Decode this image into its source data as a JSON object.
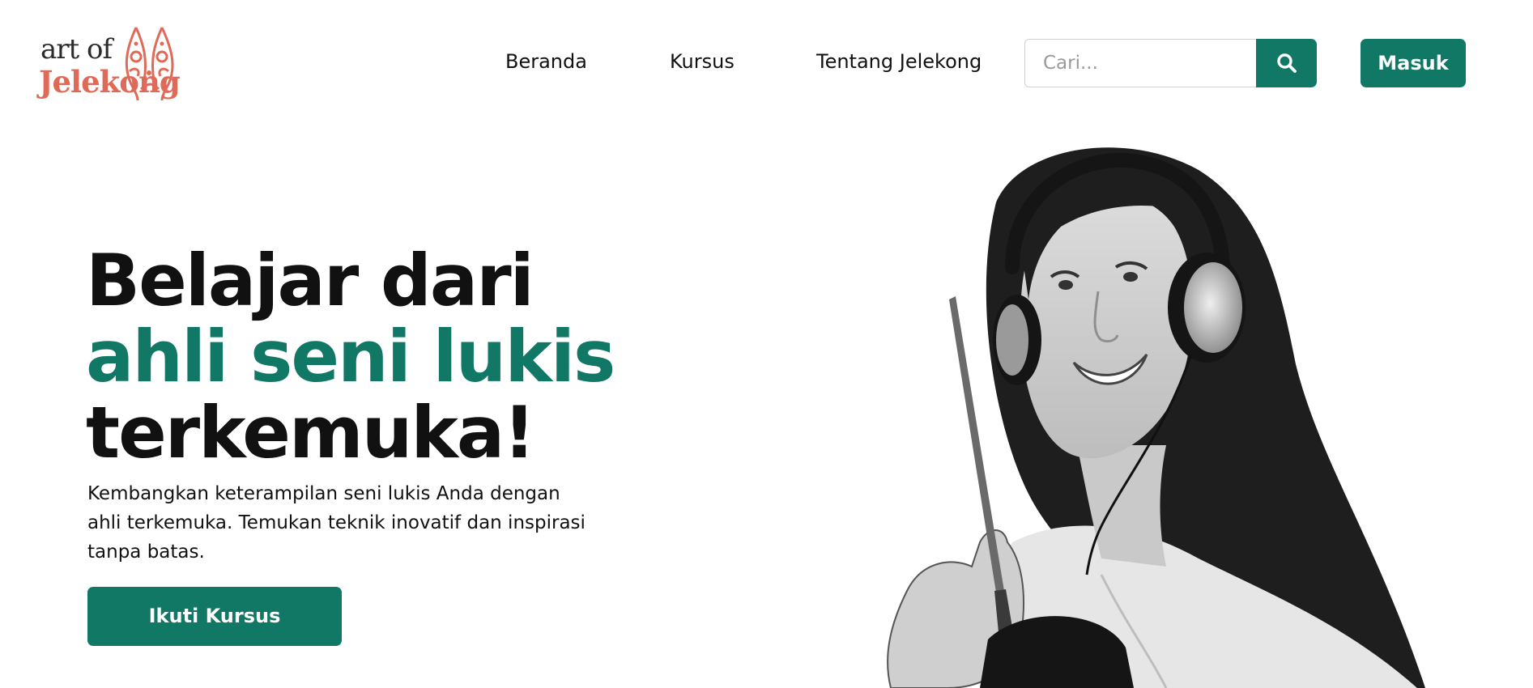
{
  "brand": {
    "logo_top": "art of",
    "logo_bottom": "Jelekong",
    "logo_color": "#e06a58"
  },
  "nav": {
    "items": [
      {
        "label": "Beranda"
      },
      {
        "label": "Kursus"
      },
      {
        "label": "Tentang Jelekong"
      }
    ]
  },
  "search": {
    "placeholder": "Cari...",
    "value": "",
    "icon": "search-icon"
  },
  "auth": {
    "login_label": "Masuk"
  },
  "hero": {
    "title_line1": "Belajar dari",
    "title_line2": "ahli seni lukis",
    "title_line3": "terkemuka!",
    "description": "Kembangkan keterampilan seni lukis Anda dengan ahli terkemuka. Temukan teknik inovatif dan inspirasi tanpa batas.",
    "cta_label": "Ikuti Kursus"
  },
  "colors": {
    "primary": "#127866",
    "text": "#111111",
    "logo": "#e06a58"
  }
}
